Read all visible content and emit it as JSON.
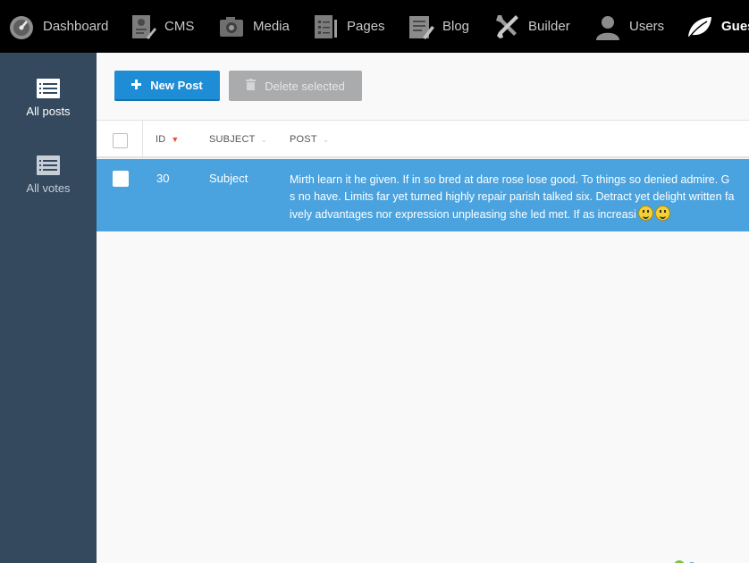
{
  "topnav": {
    "items": [
      {
        "label": "Dashboard",
        "icon": "speedometer-icon"
      },
      {
        "label": "CMS",
        "icon": "cms-icon"
      },
      {
        "label": "Media",
        "icon": "camera-icon"
      },
      {
        "label": "Pages",
        "icon": "pages-icon"
      },
      {
        "label": "Blog",
        "icon": "blog-icon"
      },
      {
        "label": "Builder",
        "icon": "tools-icon"
      },
      {
        "label": "Users",
        "icon": "user-icon"
      },
      {
        "label": "Gues",
        "icon": "leaf-icon"
      }
    ]
  },
  "sidebar": {
    "items": [
      {
        "label": "All posts",
        "icon": "list-icon",
        "active": true
      },
      {
        "label": "All votes",
        "icon": "list-icon",
        "active": false
      }
    ]
  },
  "toolbar": {
    "new_label": "New Post",
    "delete_label": "Delete selected"
  },
  "grid": {
    "columns": [
      "ID",
      "SUBJECT",
      "POST"
    ],
    "rows": [
      {
        "id": "30",
        "subject": "Subject",
        "post_lines": [
          "Mirth learn it he given. If in so bred at dare rose lose good. To things so denied admire. G",
          "s no have. Limits far yet turned highly repair parish talked six. Detract yet delight written fa",
          "ively advantages nor expression unpleasing she led met. If as increasi"
        ]
      }
    ]
  },
  "colors": {
    "topnav_bg": "#000000",
    "sidebar_bg": "#34495e",
    "primary_button": "#1f8dd6",
    "disabled_button": "#a9abad",
    "selected_row": "#4aa3df",
    "sort_caret": "#e0542f"
  }
}
